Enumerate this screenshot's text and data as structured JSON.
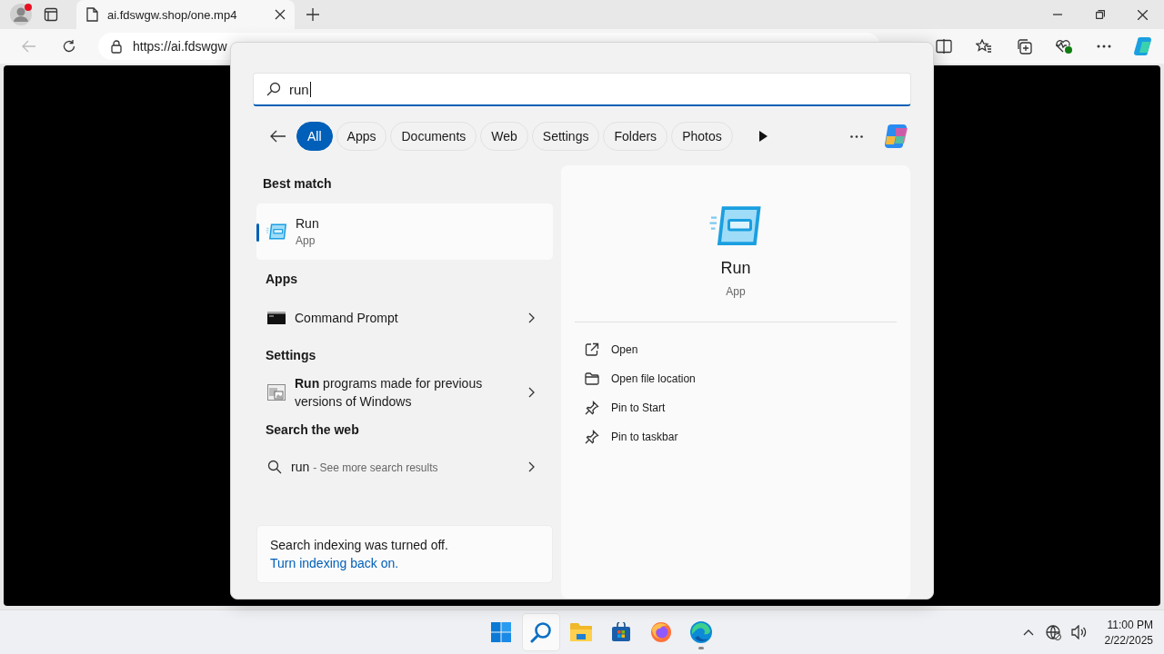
{
  "browser": {
    "tab_title": "ai.fdswgw.shop/one.mp4",
    "address": "https://ai.fdswgw"
  },
  "search": {
    "query": "run",
    "filters": [
      {
        "label": "All",
        "selected": true
      },
      {
        "label": "Apps",
        "selected": false
      },
      {
        "label": "Documents",
        "selected": false
      },
      {
        "label": "Web",
        "selected": false
      },
      {
        "label": "Settings",
        "selected": false
      },
      {
        "label": "Folders",
        "selected": false
      },
      {
        "label": "Photos",
        "selected": false
      }
    ],
    "best_match": {
      "heading": "Best match",
      "title": "Run",
      "subtitle": "App",
      "selected": true
    },
    "sections": [
      {
        "heading": "Apps",
        "items": [
          {
            "kind": "app",
            "text": "Command Prompt"
          }
        ]
      },
      {
        "heading": "Settings",
        "items": [
          {
            "kind": "setting",
            "text": "**Run** programs made for previous versions of Windows"
          }
        ]
      },
      {
        "heading": "Search the web",
        "items": [
          {
            "kind": "web",
            "text": "run",
            "hint": "- See more search results"
          }
        ]
      }
    ],
    "notice": {
      "text": "Search indexing was turned off.",
      "link": "Turn indexing back on."
    },
    "preview": {
      "title": "Run",
      "subtitle": "App",
      "actions": [
        {
          "kind": "open",
          "label": "Open"
        },
        {
          "kind": "folder",
          "label": "Open file location"
        },
        {
          "kind": "pin",
          "label": "Pin to Start"
        },
        {
          "kind": "pin",
          "label": "Pin to taskbar"
        }
      ]
    }
  },
  "taskbar": {
    "apps": [
      {
        "kind": "start",
        "selected": false,
        "running": false
      },
      {
        "kind": "search",
        "selected": true,
        "running": false
      },
      {
        "kind": "explorer",
        "selected": false,
        "running": false
      },
      {
        "kind": "store",
        "selected": false,
        "running": false
      },
      {
        "kind": "firefox",
        "selected": false,
        "running": false
      },
      {
        "kind": "edge",
        "selected": false,
        "running": true
      }
    ],
    "time": "11:00 PM",
    "date": "2/22/2025"
  }
}
